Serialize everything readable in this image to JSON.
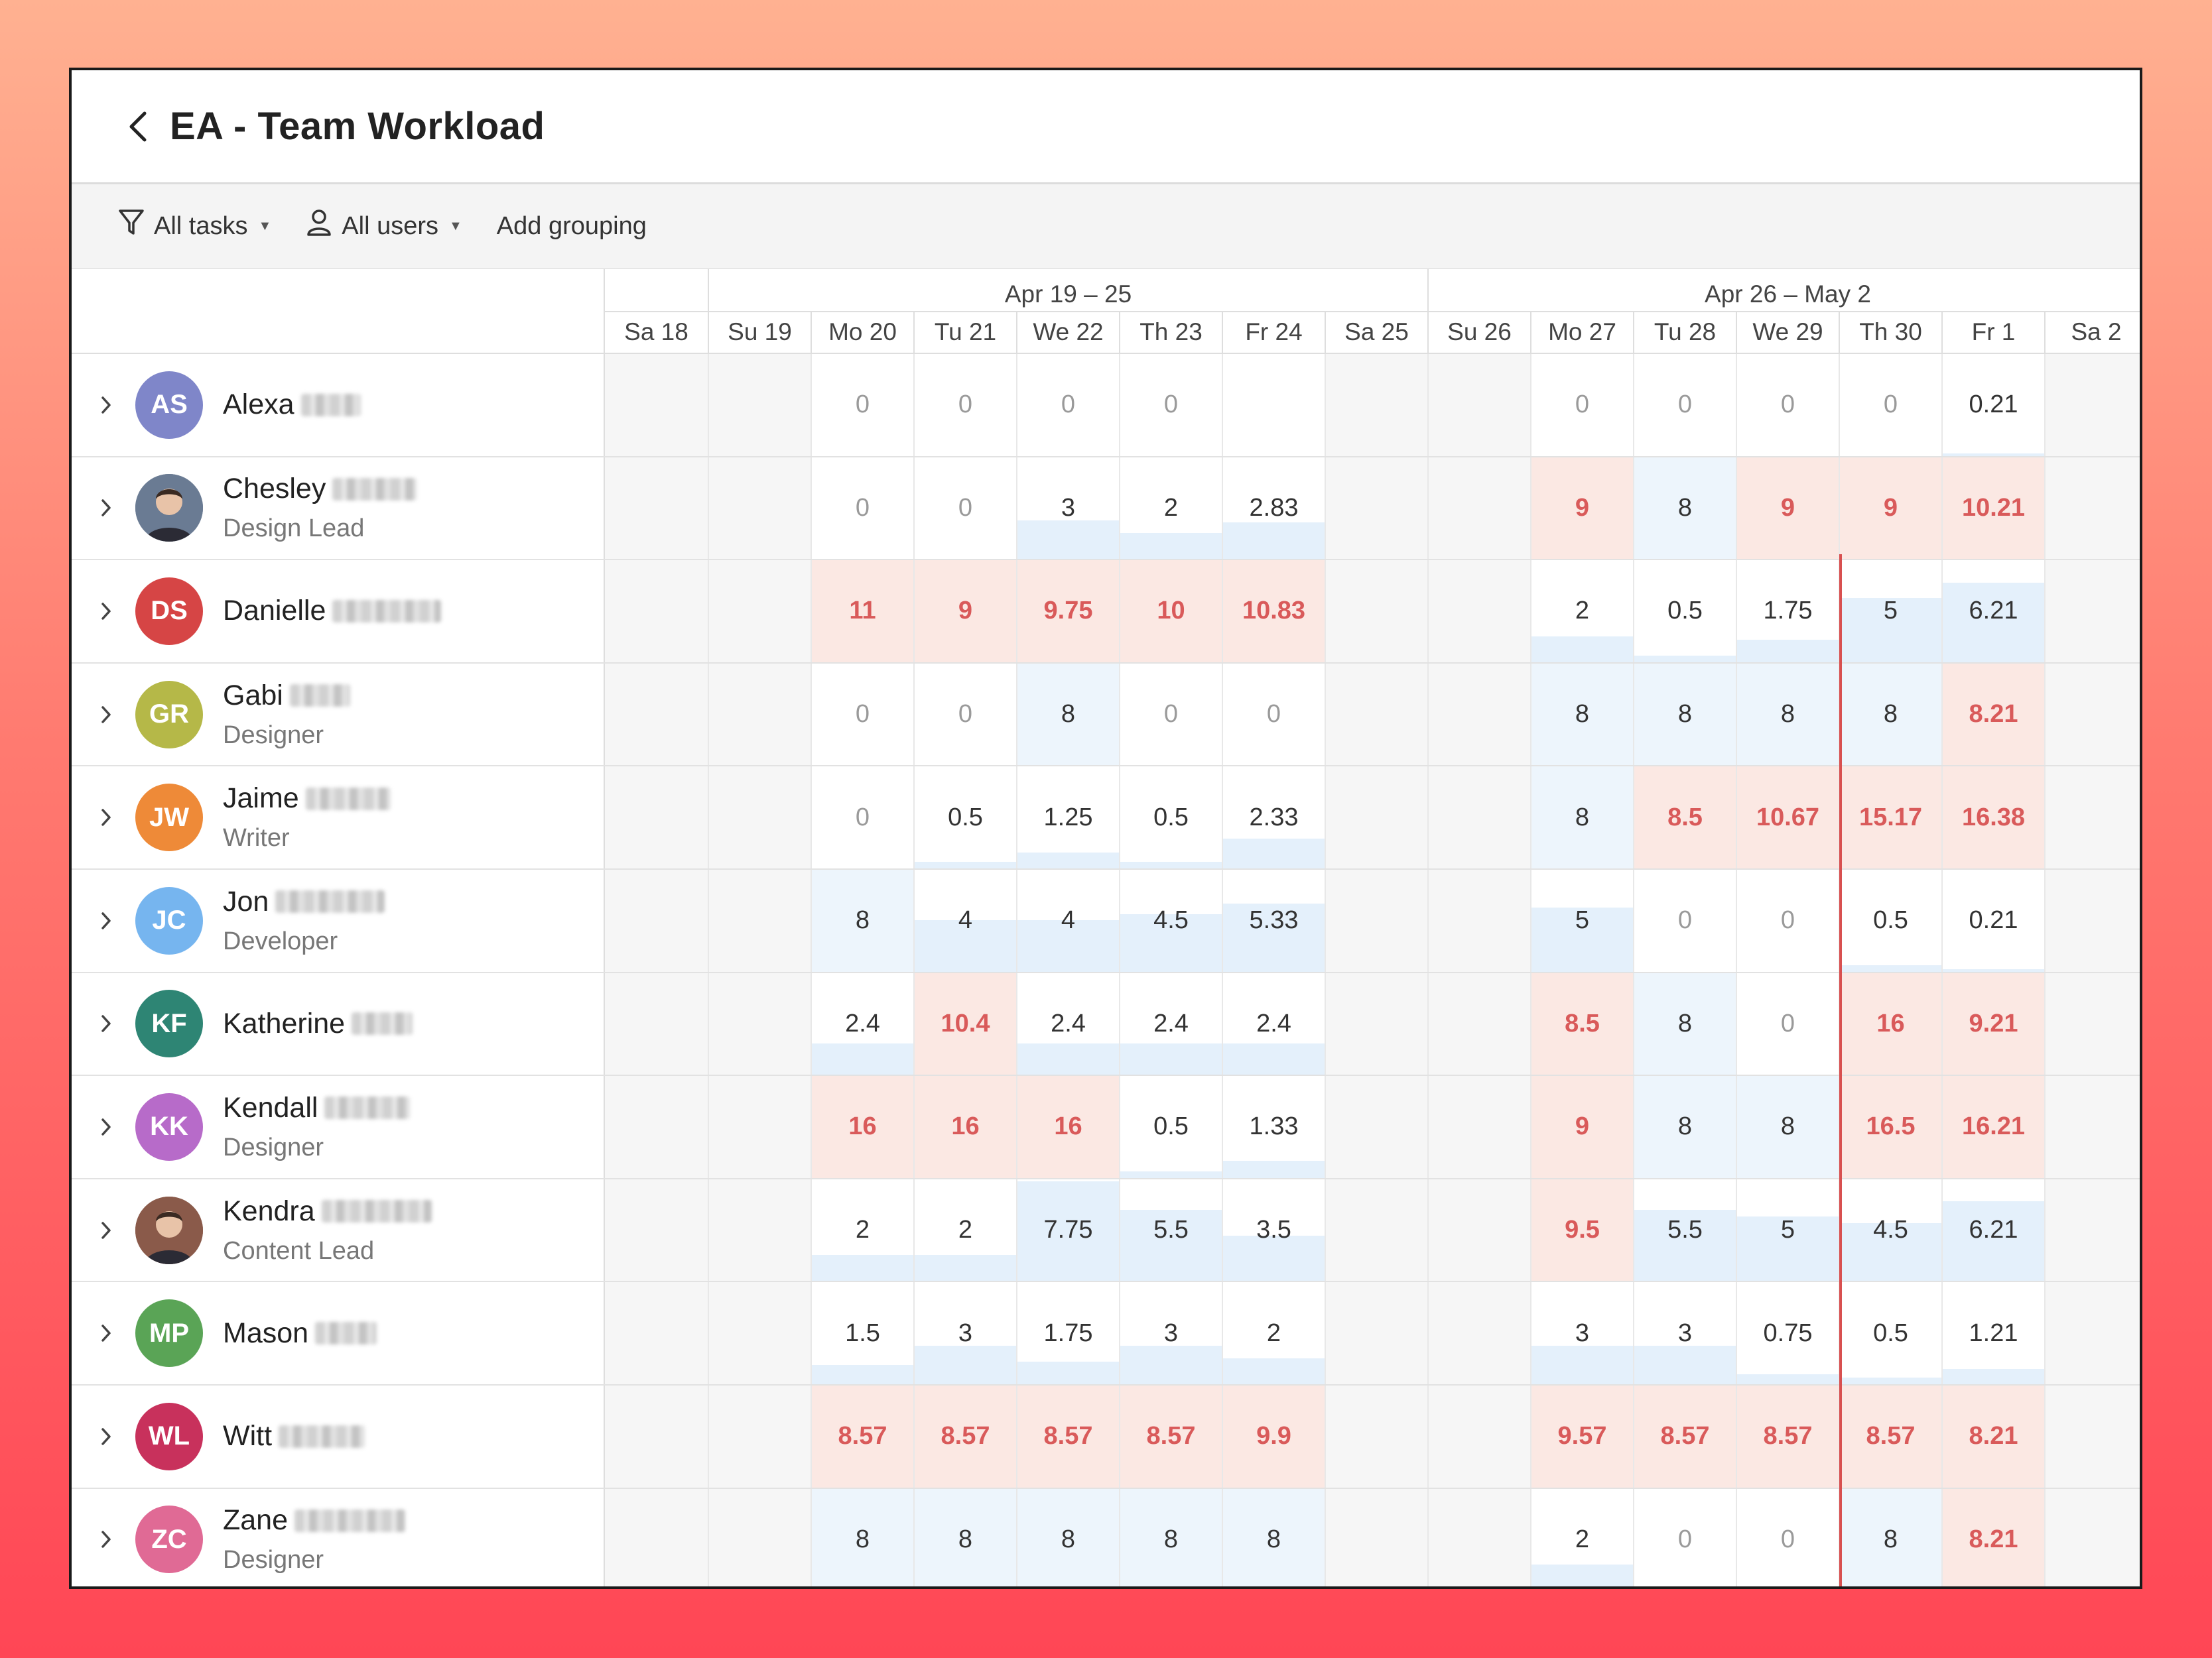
{
  "title": "EA - Team Workload",
  "toolbar": {
    "tasks": "All tasks",
    "users": "All users",
    "grouping": "Add grouping"
  },
  "weeks": [
    "Apr 19 – 25",
    "Apr 26 – May 2"
  ],
  "days": [
    "Sa 18",
    "Su 19",
    "Mo 20",
    "Tu 21",
    "We 22",
    "Th 23",
    "Fr 24",
    "Sa 25",
    "Su 26",
    "Mo 27",
    "Tu 28",
    "We 29",
    "Th 30",
    "Fr 1",
    "Sa 2"
  ],
  "colors": {
    "over_bg": "#fbe8e3",
    "over_text": "#d95a5a",
    "full_bg": "#edf5fc",
    "bar": "#e4f0fb",
    "today": "#d85050"
  },
  "people": [
    {
      "initials": "AS",
      "name": "Alexa",
      "role": "",
      "color": "#7f86c9",
      "values": [
        "",
        "",
        "0",
        "0",
        "0",
        "0",
        "",
        "",
        "",
        "0",
        "0",
        "0",
        "0",
        "0.21",
        ""
      ]
    },
    {
      "initials": "",
      "name": "Chesley",
      "role": "Design Lead",
      "color": "#6a7b93",
      "photo": true,
      "values": [
        "",
        "",
        "0",
        "0",
        "3",
        "2",
        "2.83",
        "",
        "",
        "9",
        "8",
        "9",
        "9",
        "10.21",
        ""
      ]
    },
    {
      "initials": "DS",
      "name": "Danielle",
      "role": "",
      "color": "#d64545",
      "values": [
        "",
        "",
        "11",
        "9",
        "9.75",
        "10",
        "10.83",
        "",
        "",
        "2",
        "0.5",
        "1.75",
        "5",
        "6.21",
        ""
      ]
    },
    {
      "initials": "GR",
      "name": "Gabi",
      "role": "Designer",
      "color": "#b5b848",
      "values": [
        "",
        "",
        "0",
        "0",
        "8",
        "0",
        "0",
        "",
        "",
        "8",
        "8",
        "8",
        "8",
        "8.21",
        ""
      ]
    },
    {
      "initials": "JW",
      "name": "Jaime",
      "role": "Writer",
      "color": "#ee8a38",
      "values": [
        "",
        "",
        "0",
        "0.5",
        "1.25",
        "0.5",
        "2.33",
        "",
        "",
        "8",
        "8.5",
        "10.67",
        "15.17",
        "16.38",
        ""
      ]
    },
    {
      "initials": "JC",
      "name": "Jon",
      "role": "Developer",
      "color": "#76b5ef",
      "values": [
        "",
        "",
        "8",
        "4",
        "4",
        "4.5",
        "5.33",
        "",
        "",
        "5",
        "0",
        "0",
        "0.5",
        "0.21",
        ""
      ]
    },
    {
      "initials": "KF",
      "name": "Katherine",
      "role": "",
      "color": "#2e8574",
      "values": [
        "",
        "",
        "2.4",
        "10.4",
        "2.4",
        "2.4",
        "2.4",
        "",
        "",
        "8.5",
        "8",
        "0",
        "16",
        "9.21",
        ""
      ]
    },
    {
      "initials": "KK",
      "name": "Kendall",
      "role": "Designer",
      "color": "#b76bc9",
      "values": [
        "",
        "",
        "16",
        "16",
        "16",
        "0.5",
        "1.33",
        "",
        "",
        "9",
        "8",
        "8",
        "16.5",
        "16.21",
        ""
      ]
    },
    {
      "initials": "",
      "name": "Kendra",
      "role": "Content Lead",
      "color": "#8a5a4a",
      "photo": true,
      "values": [
        "",
        "",
        "2",
        "2",
        "7.75",
        "5.5",
        "3.5",
        "",
        "",
        "9.5",
        "5.5",
        "5",
        "4.5",
        "6.21",
        ""
      ]
    },
    {
      "initials": "MP",
      "name": "Mason",
      "role": "",
      "color": "#5aa456",
      "values": [
        "",
        "",
        "1.5",
        "3",
        "1.75",
        "3",
        "2",
        "",
        "",
        "3",
        "3",
        "0.75",
        "0.5",
        "1.21",
        ""
      ]
    },
    {
      "initials": "WL",
      "name": "Witt",
      "role": "",
      "color": "#c8315c",
      "values": [
        "",
        "",
        "8.57",
        "8.57",
        "8.57",
        "8.57",
        "9.9",
        "",
        "",
        "9.57",
        "8.57",
        "8.57",
        "8.57",
        "8.21",
        ""
      ]
    },
    {
      "initials": "ZC",
      "name": "Zane",
      "role": "Designer",
      "color": "#e06a95",
      "values": [
        "",
        "",
        "8",
        "8",
        "8",
        "8",
        "8",
        "",
        "",
        "2",
        "0",
        "0",
        "8",
        "8.21",
        ""
      ]
    }
  ]
}
